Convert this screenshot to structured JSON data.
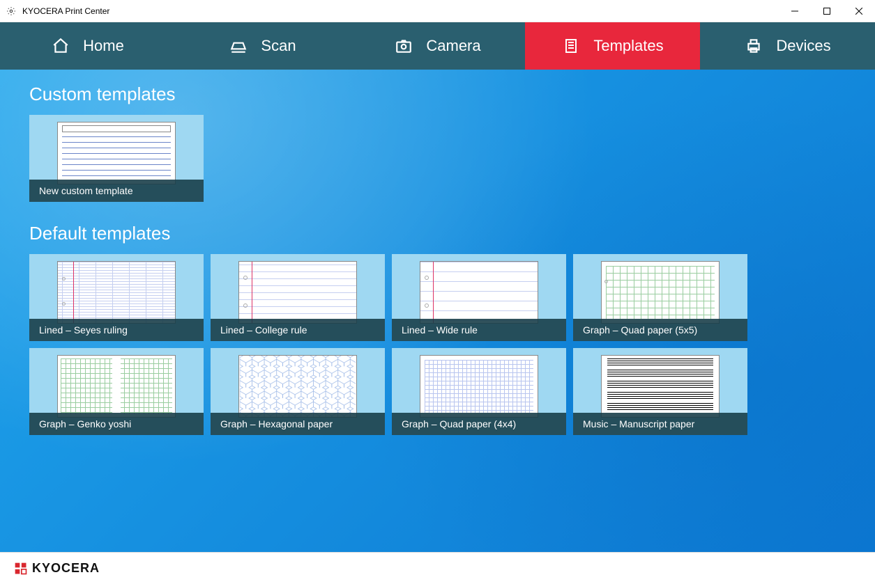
{
  "window": {
    "title": "KYOCERA Print Center"
  },
  "nav": {
    "items": [
      {
        "label": "Home"
      },
      {
        "label": "Scan"
      },
      {
        "label": "Camera"
      },
      {
        "label": "Templates"
      },
      {
        "label": "Devices"
      }
    ],
    "active_index": 3
  },
  "sections": {
    "custom": {
      "title": "Custom templates",
      "items": [
        {
          "label": "New custom template"
        }
      ]
    },
    "default": {
      "title": "Default templates",
      "items": [
        {
          "label": "Lined – Seyes ruling"
        },
        {
          "label": "Lined – College rule"
        },
        {
          "label": "Lined – Wide rule"
        },
        {
          "label": "Graph – Quad paper (5x5)"
        },
        {
          "label": "Graph – Genko yoshi"
        },
        {
          "label": "Graph – Hexagonal paper"
        },
        {
          "label": "Graph – Quad paper (4x4)"
        },
        {
          "label": "Music – Manuscript paper"
        }
      ]
    }
  },
  "footer": {
    "brand": "KYOCERA"
  }
}
